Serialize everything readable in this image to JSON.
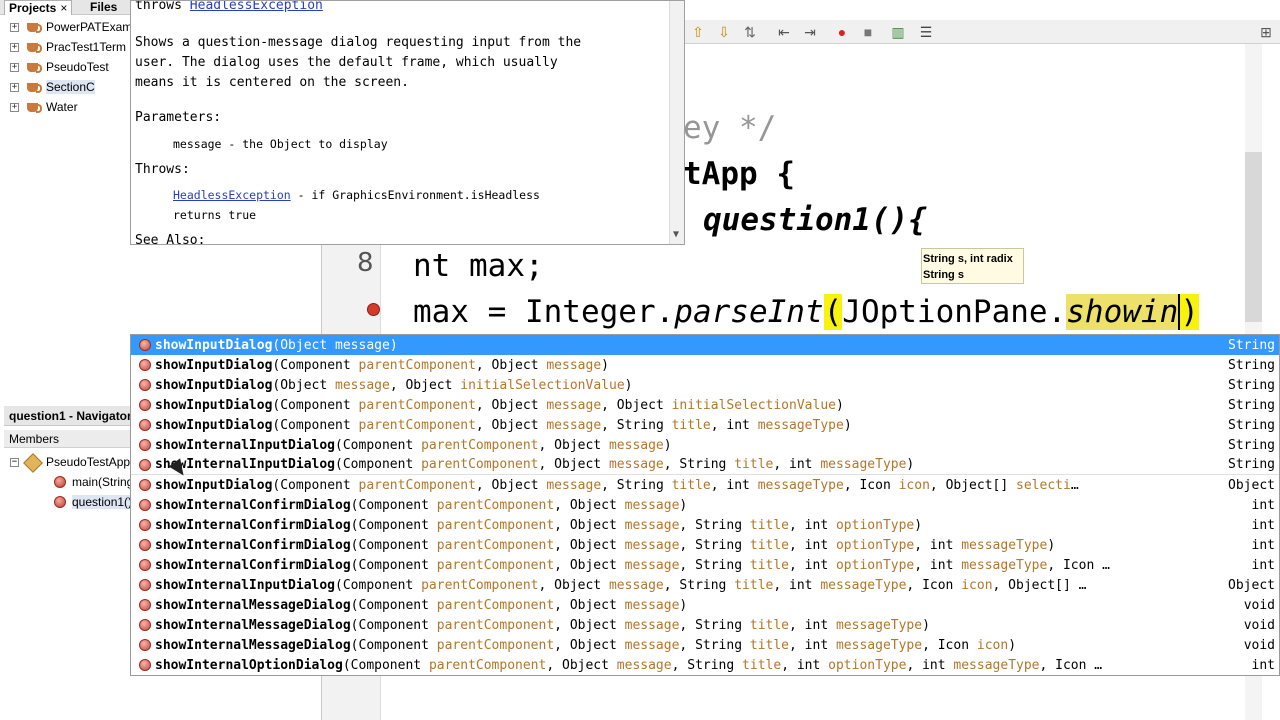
{
  "projects_panel": {
    "tabs": {
      "projects": "Projects",
      "close": "×",
      "files": "Files"
    },
    "tree": [
      {
        "label": "PowerPATExam",
        "expander": "+"
      },
      {
        "label": "PracTest1Term",
        "expander": "+"
      },
      {
        "label": "PseudoTest",
        "expander": "+"
      },
      {
        "label": "SectionC",
        "expander": "+"
      },
      {
        "label": "Water",
        "expander": "+"
      }
    ]
  },
  "navigator": {
    "title": "question1 - Navigator",
    "members_label": "Members",
    "class_name": "PseudoTestApp",
    "methods": [
      "main(String[] args)",
      "question1()"
    ]
  },
  "javadoc": {
    "throws_prefix": "throws",
    "throws_link": "HeadlessException",
    "description": "Shows a question-message dialog requesting input from the\nuser. The dialog uses the default frame, which usually\nmeans it is centered on the screen.",
    "parameters_label": "Parameters:",
    "param_text": "message - the Object to display",
    "throws_label": "Throws:",
    "throws_detail_link": "HeadlessException",
    "throws_detail_text": " - if GraphicsEnvironment.isHeadless",
    "throws_detail_text2": "returns true",
    "see_also_label": "See Also:"
  },
  "editor": {
    "line_number": "8",
    "comment_text": "ey */",
    "class_decl": "tApp {",
    "method_decl": "question1(){",
    "var_decl": "nt max;",
    "assign_prefix": "max = Integer.",
    "parse_int": "parseInt",
    "open_paren": "(",
    "joption": "JOptionPane.",
    "showin": "showin",
    "close_paren": ")"
  },
  "param_tooltip": {
    "line1": "String s, int radix",
    "line2": "String s"
  },
  "completion_items": [
    {
      "name": "showInputDialog",
      "params": "(Object message)",
      "ret": "String"
    },
    {
      "name": "showInputDialog",
      "params": "(Component parentComponent, Object message)",
      "ret": "String"
    },
    {
      "name": "showInputDialog",
      "params": "(Object message, Object initialSelectionValue)",
      "ret": "String"
    },
    {
      "name": "showInputDialog",
      "params": "(Component parentComponent, Object message, Object initialSelectionValue)",
      "ret": "String"
    },
    {
      "name": "showInputDialog",
      "params": "(Component parentComponent, Object message, String title, int messageType)",
      "ret": "String"
    },
    {
      "name": "showInternalInputDialog",
      "params": "(Component parentComponent, Object message)",
      "ret": "String"
    },
    {
      "name": "showInternalInputDialog",
      "params": "(Component parentComponent, Object message, String title, int messageType)",
      "ret": "String"
    },
    {
      "name": "showInputDialog",
      "params": "(Component parentComponent, Object message, String title, int messageType, Icon icon, Object[] selecti…",
      "ret": "Object"
    },
    {
      "name": "showInternalConfirmDialog",
      "params": "(Component parentComponent, Object message)",
      "ret": "int"
    },
    {
      "name": "showInternalConfirmDialog",
      "params": "(Component parentComponent, Object message, String title, int optionType)",
      "ret": "int"
    },
    {
      "name": "showInternalConfirmDialog",
      "params": "(Component parentComponent, Object message, String title, int optionType, int messageType)",
      "ret": "int"
    },
    {
      "name": "showInternalConfirmDialog",
      "params": "(Component parentComponent, Object message, String title, int optionType, int messageType, Icon …",
      "ret": "int"
    },
    {
      "name": "showInternalInputDialog",
      "params": "(Component parentComponent, Object message, String title, int messageType, Icon icon, Object[] …",
      "ret": "Object"
    },
    {
      "name": "showInternalMessageDialog",
      "params": "(Component parentComponent, Object message)",
      "ret": "void"
    },
    {
      "name": "showInternalMessageDialog",
      "params": "(Component parentComponent, Object message, String title, int messageType)",
      "ret": "void"
    },
    {
      "name": "showInternalMessageDialog",
      "params": "(Component parentComponent, Object message, String title, int messageType, Icon icon)",
      "ret": "void"
    },
    {
      "name": "showInternalOptionDialog",
      "params": "(Component parentComponent, Object message, String title, int optionType, int messageType, Icon …",
      "ret": "int"
    }
  ],
  "colors": {
    "selection": "#3399ff",
    "param": "#b3762b",
    "highlight": "#f7f20e"
  }
}
